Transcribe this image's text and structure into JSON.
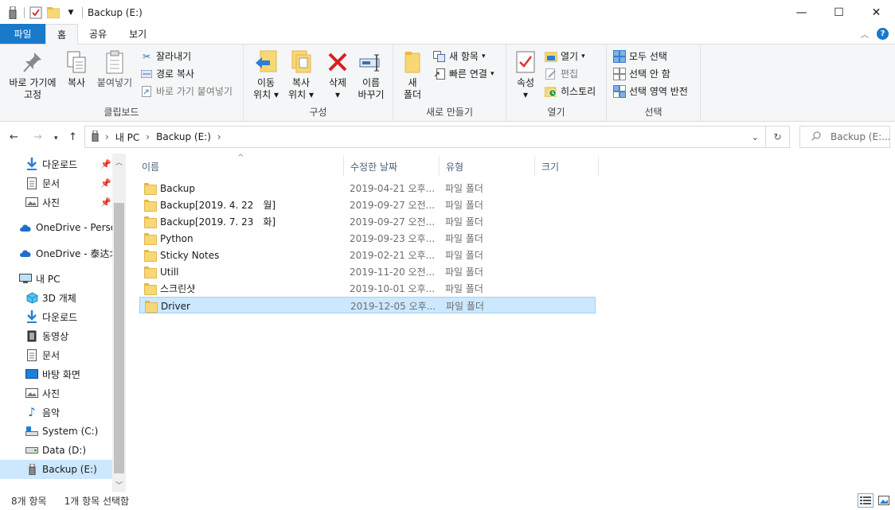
{
  "window": {
    "title": "Backup (E:)",
    "controls": [
      "—",
      "☐",
      "✕"
    ]
  },
  "ribbon_tabs": [
    "파일",
    "홈",
    "공유",
    "보기"
  ],
  "ribbon": {
    "clipboard": {
      "label": "클립보드",
      "pin_line1": "바로 가기에",
      "pin_line2": "고정",
      "copy": "복사",
      "paste": "붙여넣기",
      "cut": "잘라내기",
      "copy_path": "경로 복사",
      "paste_shortcut": "바로 가기 붙여넣기"
    },
    "organize": {
      "label": "구성",
      "move_line1": "이동",
      "move_line2": "위치",
      "copy_line1": "복사",
      "copy_line2": "위치",
      "delete": "삭제",
      "rename_line1": "이름",
      "rename_line2": "바꾸기"
    },
    "new": {
      "label": "새로 만들기",
      "folder_line1": "새",
      "folder_line2": "폴더",
      "new_item": "새 항목",
      "easy_access": "빠른 연결"
    },
    "open": {
      "label": "열기",
      "properties": "속성",
      "open": "열기",
      "edit": "편집",
      "history": "히스토리"
    },
    "select": {
      "label": "선택",
      "select_all": "모두 선택",
      "select_none": "선택 안 함",
      "invert": "선택 영역 반전"
    }
  },
  "address": {
    "crumbs": [
      "내 PC",
      "Backup (E:)"
    ],
    "search_placeholder": "Backup (E:..."
  },
  "nav_pane": {
    "items": [
      {
        "label": "다운로드",
        "icon": "download-icon",
        "pinned": true
      },
      {
        "label": "문서",
        "icon": "document-icon",
        "pinned": true
      },
      {
        "label": "사진",
        "icon": "pictures-icon",
        "pinned": true
      },
      {
        "label": "OneDrive - Person",
        "icon": "cloud-icon"
      },
      {
        "label": "OneDrive - 泰达北",
        "icon": "cloud-icon"
      },
      {
        "label": "내 PC",
        "icon": "pc-icon"
      },
      {
        "label": "3D 개체",
        "icon": "cube-icon"
      },
      {
        "label": "다운로드",
        "icon": "download-icon"
      },
      {
        "label": "동영상",
        "icon": "video-icon"
      },
      {
        "label": "문서",
        "icon": "document-icon"
      },
      {
        "label": "바탕 화면",
        "icon": "desktop-icon"
      },
      {
        "label": "사진",
        "icon": "pictures-icon"
      },
      {
        "label": "음악",
        "icon": "music-icon"
      },
      {
        "label": "System (C:)",
        "icon": "drive-icon"
      },
      {
        "label": "Data (D:)",
        "icon": "drive-icon"
      },
      {
        "label": "Backup (E:)",
        "icon": "usb-drive-icon",
        "selected": true
      }
    ]
  },
  "columns": [
    "이름",
    "수정한 날짜",
    "유형",
    "크기"
  ],
  "files": [
    {
      "name": "Backup",
      "date": "2019-04-21 오후...",
      "type": "파일 폴더"
    },
    {
      "name": "Backup[2019. 4. 22　월]",
      "date": "2019-09-27 오전...",
      "type": "파일 폴더"
    },
    {
      "name": "Backup[2019. 7. 23　화]",
      "date": "2019-09-27 오전...",
      "type": "파일 폴더"
    },
    {
      "name": "Python",
      "date": "2019-09-23 오후...",
      "type": "파일 폴더"
    },
    {
      "name": "Sticky Notes",
      "date": "2019-02-21 오후...",
      "type": "파일 폴더"
    },
    {
      "name": "Utill",
      "date": "2019-11-20 오전...",
      "type": "파일 폴더"
    },
    {
      "name": "스크린샷",
      "date": "2019-10-01 오후...",
      "type": "파일 폴더"
    },
    {
      "name": "Driver",
      "date": "2019-12-05 오후...",
      "type": "파일 폴더",
      "selected": true
    }
  ],
  "status": {
    "count": "8개 항목",
    "selected": "1개 항목 선택함"
  }
}
